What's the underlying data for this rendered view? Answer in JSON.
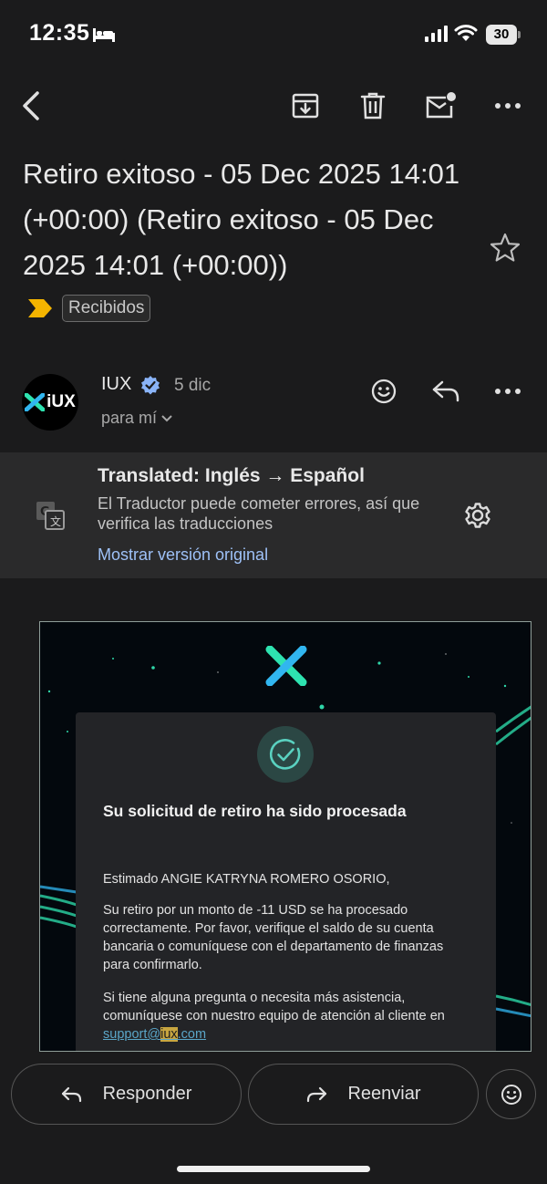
{
  "status_bar": {
    "time": "12:35",
    "battery": "30"
  },
  "toolbar": {
    "back": "back-arrow-icon",
    "archive": "archive-icon",
    "delete": "trash-icon",
    "mark_unread": "mark-unread-icon",
    "more": "more-horizontal-icon"
  },
  "email": {
    "subject": "Retiro exitoso - 05 Dec 2025 14:01 (+00:00) (Retiro exitoso - 05 Dec 2025 14:01 (+00:00))",
    "label": "Recibidos",
    "sender": {
      "avatar_text": "iUX",
      "name": "IUX",
      "date": "5 dic",
      "recipient": "para mí"
    }
  },
  "translation": {
    "title": "Translated: Inglés → Español",
    "note": "El Traductor puede cometer errores, así que verifica las traducciones",
    "link": "Mostrar versión original"
  },
  "message": {
    "heading": "Su solicitud de retiro ha sido procesada",
    "greeting": "Estimado ANGIE KATRYNA ROMERO OSORIO,",
    "paragraph1": "Su retiro por un monto de -11 USD se ha procesado correctamente. Por favor, verifique el saldo de su cuenta bancaria o comuníquese con el departamento de finanzas para confirmarlo.",
    "paragraph2_prefix": "Si tiene alguna pregunta o necesita más asistencia, comuníquese con nuestro equipo de atención al cliente en ",
    "email_part1": "support@",
    "email_highlight": "iux",
    "email_part2": ".com"
  },
  "actions": {
    "reply": "Responder",
    "forward": "Reenviar"
  },
  "colors": {
    "background": "#1b1b1c",
    "banner": "#2a2a2b",
    "link": "#9ec1f7",
    "accent_teal": "#2fd6a8",
    "importance": "#f4b400"
  }
}
